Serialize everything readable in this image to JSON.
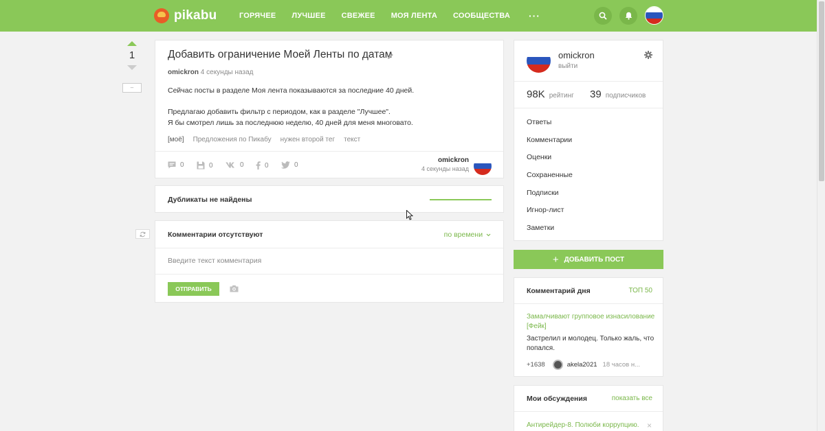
{
  "header": {
    "logo_text": "pikabu",
    "nav": [
      "ГОРЯЧЕЕ",
      "ЛУЧШЕЕ",
      "СВЕЖЕЕ",
      "МОЯ ЛЕНТА",
      "СООБЩЕСТВА"
    ],
    "more": "···",
    "icons": [
      "search-icon",
      "bell-icon",
      "russia-flag-avatar"
    ],
    "accent_color": "#8ac858"
  },
  "rating": {
    "value": "1",
    "collapse_label": "–"
  },
  "story": {
    "title": "Добавить ограничение Моей Ленты по датам",
    "author": "omickron",
    "time": "4 секунды назад",
    "paragraph1": "Сейчас посты в разделе Моя лента показываются за последние 40 дней.",
    "paragraph2": "Предлагаю добавить фильтр с периодом, как в разделе \"Лучшее\".",
    "paragraph3": "Я бы смотрел лишь за последнюю неделю, 40 дней для меня многовато.",
    "tags": [
      "[моё]",
      "Предложения по Пикабу",
      "нужен второй тег",
      "текст"
    ],
    "actions": {
      "comments": "0",
      "saves": "0",
      "vk": "0",
      "facebook": "0",
      "twitter": "0"
    },
    "footer_author": "omickron",
    "footer_time": "4 секунды назад"
  },
  "duplicates": {
    "label": "Дубликаты не найдены"
  },
  "comments": {
    "label": "Комментарии отсутствуют",
    "sort": "по времени",
    "placeholder": "Введите текст комментария",
    "send": "ОТПРАВИТЬ"
  },
  "profile": {
    "name": "omickron",
    "logout": "выйти",
    "rating_value": "98K",
    "rating_label": "рейтинг",
    "subscribers_value": "39",
    "subscribers_label": "подписчиков",
    "menu": [
      "Ответы",
      "Комментарии",
      "Оценки",
      "Сохраненные",
      "Подписки",
      "Игнор-лист",
      "Заметки"
    ]
  },
  "add_post": {
    "plus": "+",
    "label": "ДОБАВИТЬ ПОСТ"
  },
  "comment_of_day": {
    "title": "Комментарий дня",
    "top": "ТОП 50",
    "link": "Замалчивают групповое изнасилование [Фейк]",
    "text": "Застрелил и молодец. Только жаль, что попался.",
    "rating": "+1638",
    "user": "akela2021",
    "time": "18 часов н..."
  },
  "discussions": {
    "title": "Мои обсуждения",
    "show_all": "показать все",
    "item": "Антирейдер-8. Полюби коррупцию.",
    "close": "×"
  }
}
